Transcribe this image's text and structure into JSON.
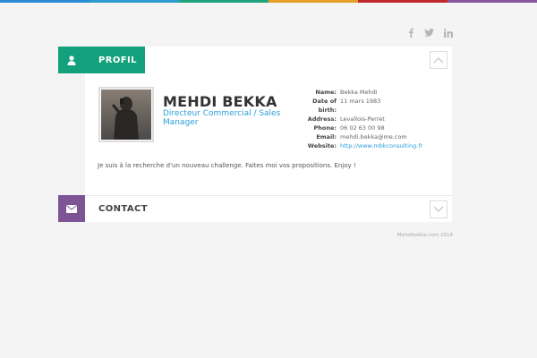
{
  "topbar_colors": [
    "#2a8cd3",
    "#2e9bd0",
    "#1fa37d",
    "#e59e2a",
    "#c0282c",
    "#8a55a0"
  ],
  "social": [
    {
      "name": "facebook-icon",
      "glyph": "f"
    },
    {
      "name": "twitter-icon",
      "glyph": "t"
    },
    {
      "name": "linkedin-icon",
      "glyph": "in"
    }
  ],
  "profil": {
    "header_label": "PROFIL",
    "accent": "#13a07c",
    "name": "MEHDI BEKKA",
    "title": "Directeur Commercial / Sales Manager",
    "fields": [
      {
        "label": "Name:",
        "value": "Bekka Mehdi"
      },
      {
        "label": "Date of",
        "value": "11 mars 1983"
      },
      {
        "label": "birth:",
        "value": ""
      },
      {
        "label": "Address:",
        "value": "Levallois-Perret"
      },
      {
        "label": "Phone:",
        "value": "06 02 63 00 98"
      },
      {
        "label": "Email:",
        "value": "mehdi.bekka@me.com"
      },
      {
        "label": "Website:",
        "value": "http://www.mbkconsulting.fr"
      }
    ],
    "description": "Je suis à la recherche d'un nouveau challenge. Faites moi vos propositions. Enjoy !"
  },
  "contact": {
    "header_label": "CONTACT",
    "accent": "#7d5595"
  },
  "footer": "Mehdibekka.com 2014"
}
